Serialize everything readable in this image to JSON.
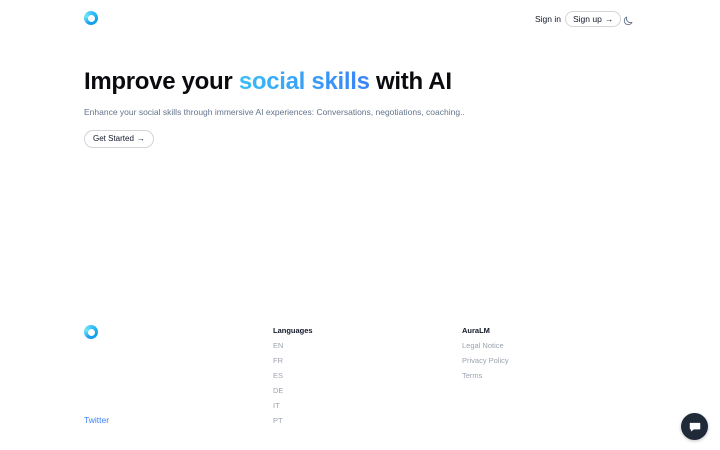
{
  "header": {
    "logo_icon": "ring-logo-icon",
    "signin_label": "Sign in",
    "signup_label": "Sign up",
    "arrow_glyph": "→",
    "theme_icon": "moon-icon"
  },
  "hero": {
    "title_before": "Improve your ",
    "title_accent": "social skills",
    "title_after": " with AI",
    "subtitle": "Enhance your social skills through immersive AI experiences: Conversations, negotiations, coaching..",
    "cta_label": "Get Started",
    "cta_arrow": "→"
  },
  "footer": {
    "twitter_label": "Twitter",
    "languages": {
      "heading": "Languages",
      "items": [
        "EN",
        "FR",
        "ES",
        "DE",
        "IT",
        "PT"
      ]
    },
    "brand": {
      "heading": "AuraLM",
      "items": [
        "Legal Notice",
        "Privacy Policy",
        "Terms"
      ]
    }
  },
  "chat_widget": {
    "icon": "chat-bubble-icon"
  },
  "colors": {
    "accent_start": "#38bdf8",
    "accent_end": "#3b82f6",
    "link": "#3b82f6",
    "muted": "#9ca3af",
    "chat_bg": "#1f2937"
  }
}
